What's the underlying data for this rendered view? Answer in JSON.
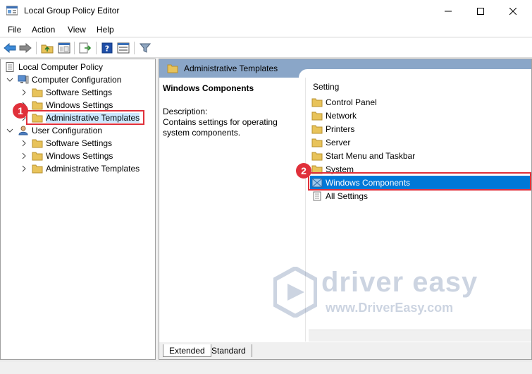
{
  "window": {
    "title": "Local Group Policy Editor",
    "minimize_icon": "minimize-icon",
    "maximize_icon": "maximize-icon",
    "close_icon": "close-icon"
  },
  "menu": {
    "items": [
      "File",
      "Action",
      "View",
      "Help"
    ]
  },
  "toolbar": {
    "icons": [
      "back-arrow-icon",
      "forward-arrow-icon",
      "up-folder-icon",
      "show-hide-tree-icon",
      "export-list-icon",
      "help-icon",
      "properties-icon",
      "filter-icon"
    ]
  },
  "tree": {
    "root": "Local Computer Policy",
    "computer_config": "Computer Configuration",
    "computer_children": [
      "Software Settings",
      "Windows Settings",
      "Administrative Templates"
    ],
    "user_config": "User Configuration",
    "user_children": [
      "Software Settings",
      "Windows Settings",
      "Administrative Templates"
    ]
  },
  "right": {
    "header_title": "Administrative Templates",
    "selected_name": "Windows Components",
    "description_label": "Description:",
    "description_text": "Contains settings for operating system components.",
    "list_header": "Setting",
    "items": [
      "Control Panel",
      "Network",
      "Printers",
      "Server",
      "Start Menu and Taskbar",
      "System",
      "Windows Components",
      "All Settings"
    ],
    "selected_index": 6
  },
  "tabs": [
    "Extended",
    "Standard"
  ],
  "active_tab": "Extended",
  "annotations": [
    "1",
    "2"
  ],
  "watermark": {
    "brand": "driver easy",
    "url": "www.DriverEasy.com"
  },
  "colors": {
    "selection": "#0078d7",
    "annotation": "#e0303a",
    "header_band": "#8aa6c8",
    "folder": "#e8c35a"
  }
}
